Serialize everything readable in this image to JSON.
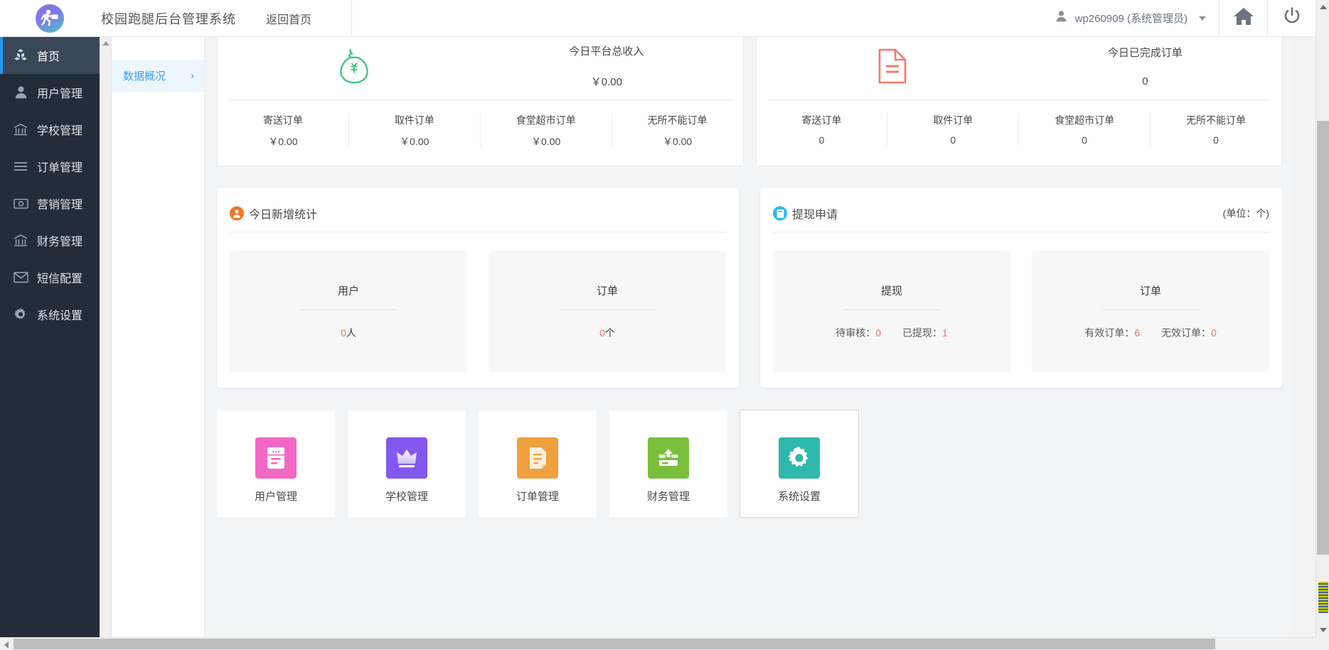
{
  "header": {
    "logo_icon": "courier-logo-icon",
    "app_title": "校园跑腿后台管理系统",
    "home_link": "返回首页",
    "user_icon": "user-icon",
    "user_name": "wp260909 (系统管理员)",
    "home_button_icon": "home-icon",
    "power_button_icon": "power-icon"
  },
  "sidebar": {
    "items": [
      {
        "label": "首页",
        "icon": "cubes-icon",
        "active": true
      },
      {
        "label": "用户管理",
        "icon": "user-icon",
        "active": false
      },
      {
        "label": "学校管理",
        "icon": "bank-icon",
        "active": false
      },
      {
        "label": "订单管理",
        "icon": "list-icon",
        "active": false
      },
      {
        "label": "营销管理",
        "icon": "money-icon",
        "active": false
      },
      {
        "label": "财务管理",
        "icon": "bank-icon",
        "active": false
      },
      {
        "label": "短信配置",
        "icon": "envelope-icon",
        "active": false
      },
      {
        "label": "系统设置",
        "icon": "gear-icon",
        "active": false
      }
    ]
  },
  "subnav": {
    "items": [
      {
        "label": "数据概况",
        "chevron": "›",
        "active": true
      }
    ]
  },
  "summary_cards": [
    {
      "icon": "money-bag-icon",
      "icon_color": "#3ec97f",
      "title": "今日平台总收入",
      "value": "￥0.00",
      "columns": [
        {
          "label": "寄送订单",
          "value": "￥0.00"
        },
        {
          "label": "取件订单",
          "value": "￥0.00"
        },
        {
          "label": "食堂超市订单",
          "value": "￥0.00"
        },
        {
          "label": "无所不能订单",
          "value": "￥0.00"
        }
      ]
    },
    {
      "icon": "document-icon",
      "icon_color": "#f4796c",
      "title": "今日已完成订单",
      "value": "0",
      "columns": [
        {
          "label": "寄送订单",
          "value": "0"
        },
        {
          "label": "取件订单",
          "value": "0"
        },
        {
          "label": "食堂超市订单",
          "value": "0"
        },
        {
          "label": "无所不能订单",
          "value": "0"
        }
      ]
    }
  ],
  "panels": [
    {
      "badge_icon": "user-add-badge-icon",
      "badge_color": "#f0772c",
      "title": "今日新增统计",
      "unit": "",
      "tiles": [
        {
          "title": "用户",
          "metrics": [
            {
              "label": "",
              "value": "0",
              "unit": "人"
            }
          ]
        },
        {
          "title": "订单",
          "metrics": [
            {
              "label": "",
              "value": "0",
              "unit": "个"
            }
          ]
        }
      ]
    },
    {
      "badge_icon": "withdraw-badge-icon",
      "badge_color": "#29b6f6",
      "title": "提现申请",
      "unit": "(单位：个)",
      "tiles": [
        {
          "title": "提现",
          "metrics": [
            {
              "label": "待审核：",
              "value": "0",
              "unit": ""
            },
            {
              "label": "已提现：",
              "value": "1",
              "unit": ""
            }
          ]
        },
        {
          "title": "订单",
          "metrics": [
            {
              "label": "有效订单：",
              "value": "6",
              "unit": ""
            },
            {
              "label": "无效订单：",
              "value": "0",
              "unit": ""
            }
          ]
        }
      ]
    }
  ],
  "shortcuts": [
    {
      "label": "用户管理",
      "icon": "form-icon",
      "color": "#f368c4",
      "selected": false
    },
    {
      "label": "学校管理",
      "icon": "crown-icon",
      "color": "#8358ef",
      "selected": false
    },
    {
      "label": "订单管理",
      "icon": "order-doc-icon",
      "color": "#f0a03c",
      "selected": false
    },
    {
      "label": "财务管理",
      "icon": "upload-icon",
      "color": "#79bf3c",
      "selected": false
    },
    {
      "label": "系统设置",
      "icon": "gear-icon",
      "color": "#2fb8ae",
      "selected": true
    }
  ],
  "colors": {
    "sidebar_bg": "#232c39",
    "sidebar_active": "#394759",
    "accent": "#2196f3",
    "number_red": "#f1736c",
    "content_bg": "#f3f4f6"
  }
}
